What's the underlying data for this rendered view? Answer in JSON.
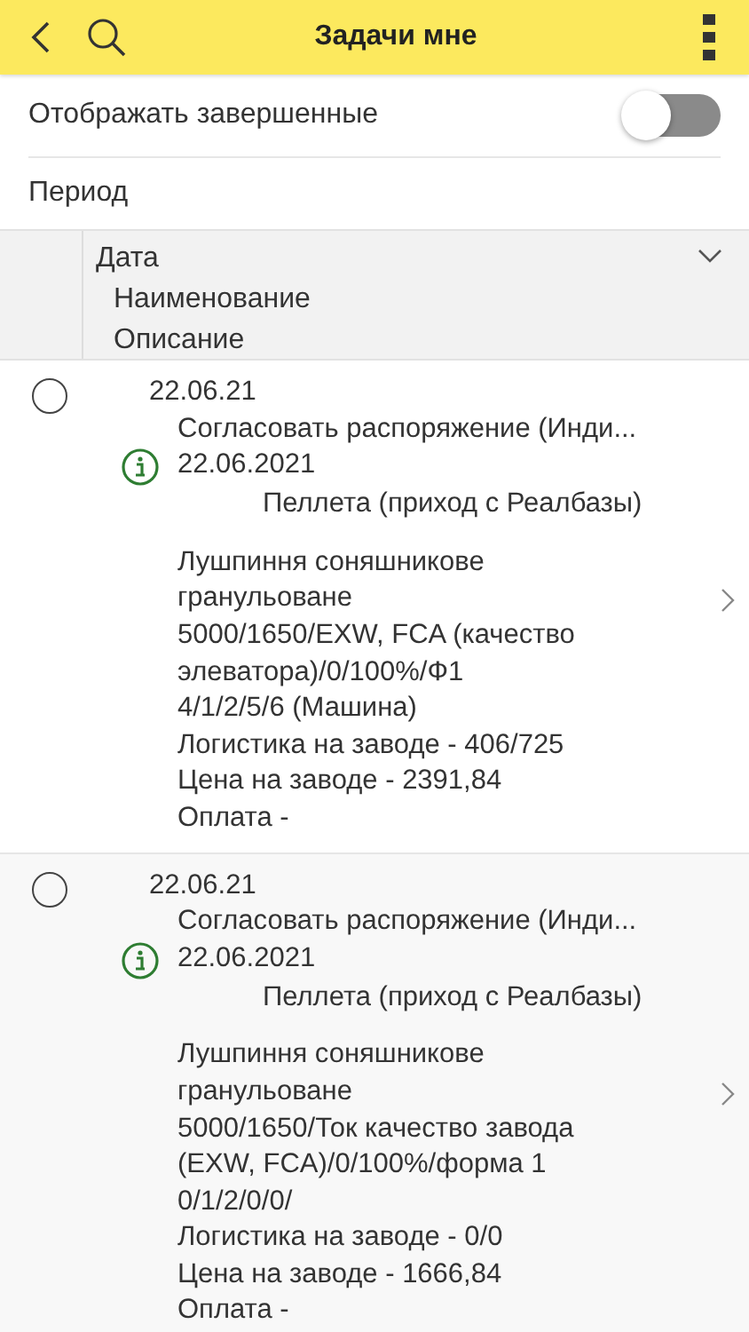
{
  "header": {
    "title": "Задачи мне"
  },
  "show_completed": {
    "label": "Отображать завершенные",
    "on": false
  },
  "period": {
    "label": "Период"
  },
  "columns": [
    "Дата",
    "Наименование",
    "Описание"
  ],
  "tasks": [
    {
      "completed": false,
      "date": "22.06.21",
      "title": "Согласовать распоряжение (Инди...",
      "created": "22.06.2021",
      "subject": "Пеллета (приход с Реалбазы)",
      "details": [
        "Лушпиння соняшникове",
        "гранульоване",
        "5000/1650/EXW, FCA (качество",
        "элеватора)/0/100%/Ф1",
        "4/1/2/5/6 (Машина)",
        "Логистика на заводе - 406/725",
        "Цена на заводе - 2391,84",
        "Оплата -"
      ]
    },
    {
      "completed": false,
      "date": "22.06.21",
      "title": "Согласовать распоряжение (Инди...",
      "created": "22.06.2021",
      "subject": "Пеллета (приход с Реалбазы)",
      "details": [
        "Лушпиння соняшникове",
        "гранульоване",
        "5000/1650/Ток качество завода",
        "(EXW, FCA)/0/100%/форма 1",
        "0/1/2/0/0/",
        "Логистика на заводе - 0/0",
        "Цена на заводе - 1666,84",
        "Оплата -"
      ]
    }
  ]
}
